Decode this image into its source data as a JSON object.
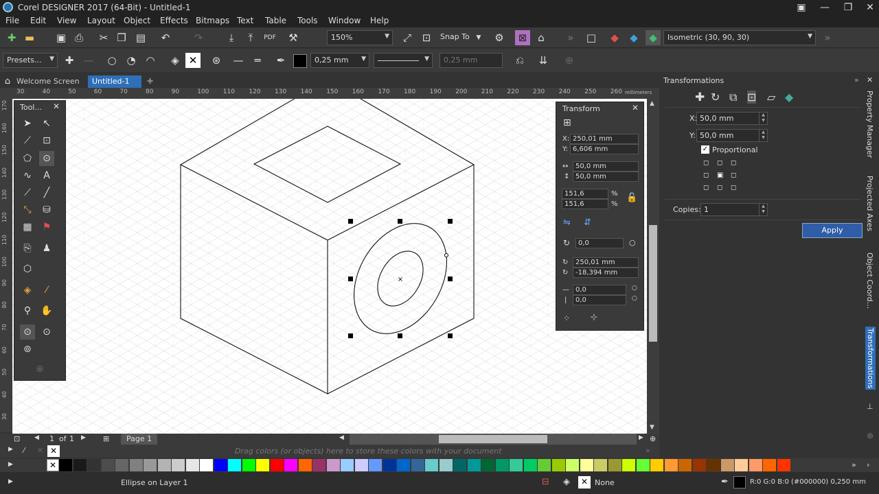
{
  "window": {
    "title": "Corel DESIGNER 2017 (64-Bit) - Untitled-1"
  },
  "menu": [
    "File",
    "Edit",
    "View",
    "Layout",
    "Object",
    "Effects",
    "Bitmaps",
    "Text",
    "Table",
    "Tools",
    "Window",
    "Help"
  ],
  "toolbar": {
    "zoom": "150%",
    "snap_label": "Snap To",
    "projection": "Isometric (30, 90, 30)"
  },
  "propbar": {
    "presets": "Presets...",
    "outline_width": "0,25 mm",
    "outline_width2": "0,25 mm"
  },
  "tabs": {
    "welcome": "Welcome Screen",
    "doc": "Untitled-1"
  },
  "ruler": {
    "h_ticks": [
      "30",
      "40",
      "50",
      "60",
      "70",
      "80",
      "90",
      "100",
      "110",
      "120",
      "130",
      "140",
      "150",
      "160",
      "170",
      "180",
      "190",
      "200",
      "210",
      "220",
      "230",
      "240",
      "250",
      "260"
    ],
    "h_unit": "millimeters",
    "v_ticks": [
      "170",
      "160",
      "150",
      "140",
      "130",
      "120",
      "110",
      "100",
      "90",
      "80",
      "70",
      "60",
      "50",
      "40",
      "30"
    ]
  },
  "toolbox": {
    "title": "Tool..."
  },
  "transform_docker": {
    "title": "Transform",
    "x": "250,01 mm",
    "y": "6,606 mm",
    "w": "50,0 mm",
    "h": "50,0 mm",
    "sx": "151,6",
    "sy": "151,6",
    "pct": "%",
    "rot": "0,0",
    "cx": "250,01 mm",
    "cy": "-18,394 mm",
    "skx": "0,0",
    "sky": "0,0",
    "x_label": "X:",
    "y_label": "Y:"
  },
  "transformations_panel": {
    "title": "Transformations",
    "x_label": "X:",
    "x": "50,0 mm",
    "y_label": "Y:",
    "y": "50,0 mm",
    "proportional": "Proportional",
    "copies_label": "Copies:",
    "copies": "1",
    "apply": "Apply"
  },
  "side_tabs": [
    "Property Manager",
    "Projected Axes",
    "Object Coord...",
    "Transformations"
  ],
  "page_nav": {
    "counter": "1",
    "of": "of",
    "total": "1",
    "page_tab": "Page 1"
  },
  "palette": {
    "drag_hint": "Drag colors (or objects) here to store these colors with your document",
    "swatches": [
      "#000000",
      "#1a1a1a",
      "#333333",
      "#4d4d4d",
      "#666666",
      "#808080",
      "#999999",
      "#b3b3b3",
      "#cccccc",
      "#e6e6e6",
      "#ffffff",
      "#0000ff",
      "#00ffff",
      "#00ff00",
      "#ffff00",
      "#ff0000",
      "#ff00ff",
      "#ff6600",
      "#993366",
      "#cc99cc",
      "#99ccff",
      "#ccccff",
      "#6699ff",
      "#003399",
      "#0066cc",
      "#336699",
      "#66cccc",
      "#99cccc",
      "#006666",
      "#009999",
      "#006633",
      "#009966",
      "#33cc99",
      "#00cc66",
      "#66cc33",
      "#99cc00",
      "#ccff66",
      "#ffff99",
      "#cccc66",
      "#999933",
      "#ccff00",
      "#66ff33",
      "#ffcc00",
      "#ff9933",
      "#cc6600",
      "#993300",
      "#663300",
      "#cc9966",
      "#ffcc99",
      "#ff9966",
      "#ff6600",
      "#ff3300"
    ]
  },
  "status": {
    "object": "Ellipse on Layer 1",
    "fill": "None",
    "outline": "R:0 G:0 B:0 (#000000)  0,250 mm"
  }
}
